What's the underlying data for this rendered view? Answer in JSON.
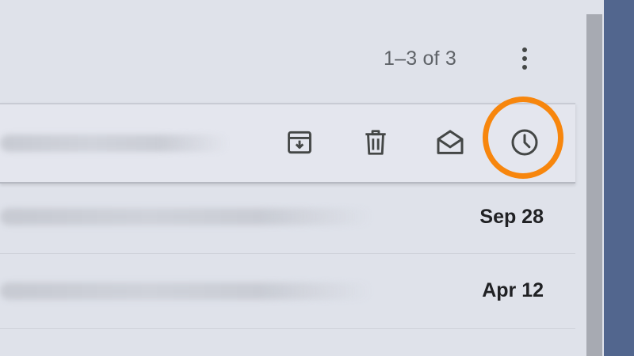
{
  "toolbar": {
    "pagination": "1–3 of 3",
    "more_icon": "more-vertical-icon"
  },
  "selected_row": {
    "actions": [
      {
        "name": "archive",
        "icon": "archive-icon"
      },
      {
        "name": "delete",
        "icon": "trash-icon"
      },
      {
        "name": "mark-as-read",
        "icon": "envelope-open-icon"
      },
      {
        "name": "snooze",
        "icon": "clock-icon"
      }
    ]
  },
  "rows": [
    {
      "date": "Sep 28"
    },
    {
      "date": "Apr 12"
    }
  ],
  "colors": {
    "highlight": "#f7860d",
    "icon": "#444746",
    "side_panel": "#52668e"
  }
}
